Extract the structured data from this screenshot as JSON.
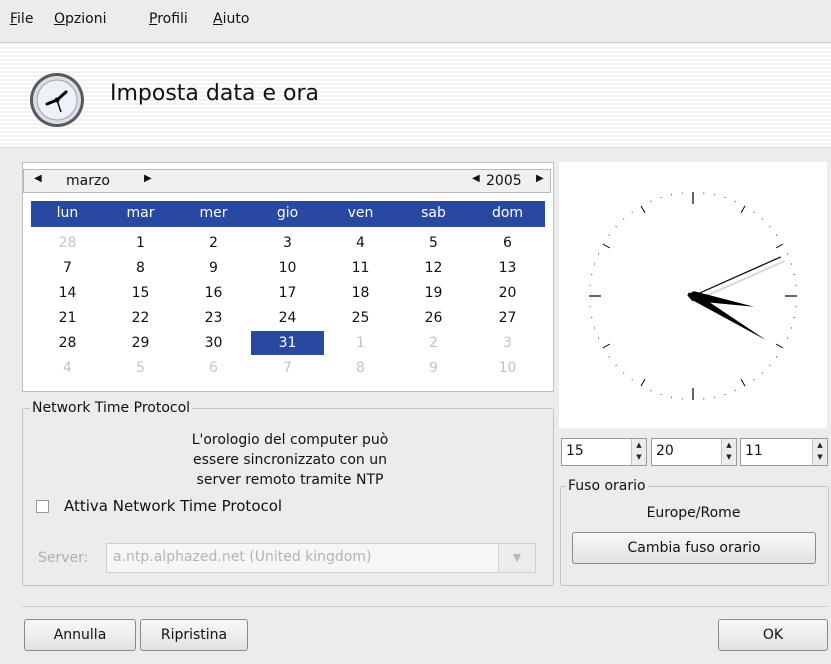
{
  "menubar": {
    "items": [
      {
        "mnemonic": "F",
        "rest": "ile"
      },
      {
        "mnemonic": "O",
        "rest": "pzioni"
      },
      {
        "mnemonic": "P",
        "rest": "rofili"
      },
      {
        "mnemonic": "A",
        "rest": "iuto"
      }
    ]
  },
  "header": {
    "title": "Imposta data e ora",
    "icon": "clock-icon"
  },
  "calendar": {
    "month": "marzo",
    "year": "2005",
    "weekdays": [
      "lun",
      "mar",
      "mer",
      "gio",
      "ven",
      "sab",
      "dom"
    ],
    "weeks": [
      [
        "28",
        "1",
        "2",
        "3",
        "4",
        "5",
        "6"
      ],
      [
        "7",
        "8",
        "9",
        "10",
        "11",
        "12",
        "13"
      ],
      [
        "14",
        "15",
        "16",
        "17",
        "18",
        "19",
        "20"
      ],
      [
        "21",
        "22",
        "23",
        "24",
        "25",
        "26",
        "27"
      ],
      [
        "28",
        "29",
        "30",
        "31",
        "1",
        "2",
        "3"
      ],
      [
        "4",
        "5",
        "6",
        "7",
        "8",
        "9",
        "10"
      ]
    ],
    "selected_day": "31"
  },
  "ntp": {
    "group_title": "Network Time Protocol",
    "description": [
      "L'orologio del computer può",
      "essere sincronizzato con un",
      "server remoto tramite NTP"
    ],
    "checkbox_label": "Attiva Network Time Protocol",
    "checked": false,
    "server_label": "Server:",
    "server_value": "a.ntp.alphazed.net  (United kingdom)"
  },
  "time": {
    "hours": "15",
    "minutes": "20",
    "seconds": "11"
  },
  "timezone": {
    "group_title": "Fuso orario",
    "value": "Europe/Rome",
    "change_button": "Cambia fuso orario"
  },
  "buttons": {
    "cancel": "Annulla",
    "reset": "Ripristina",
    "ok": "OK"
  },
  "colors": {
    "selection": "#2948a0",
    "accent_text": "#ffffff"
  }
}
